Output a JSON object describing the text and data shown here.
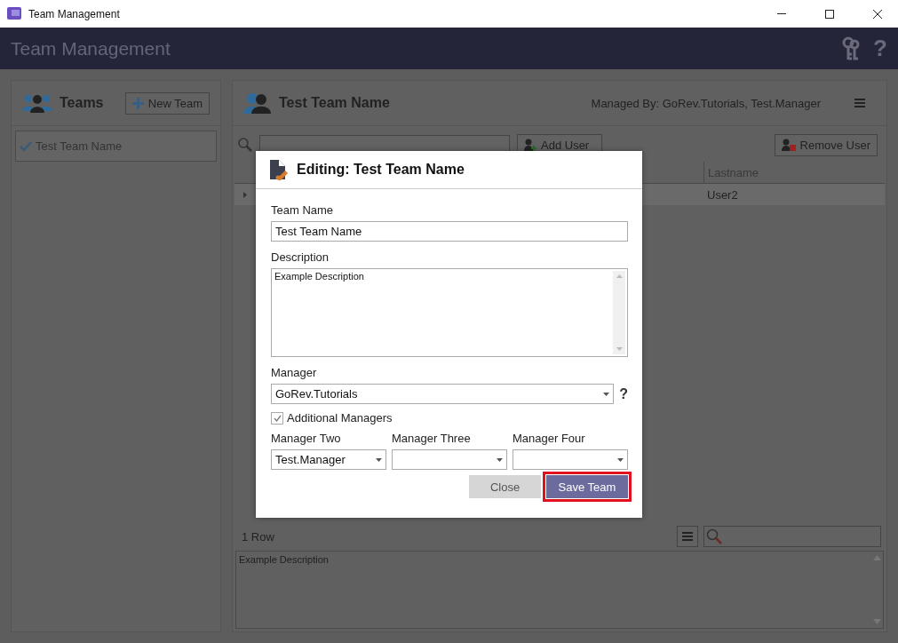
{
  "window": {
    "title": "Team Management"
  },
  "header": {
    "title": "Team Management",
    "help": "?"
  },
  "teams_panel": {
    "title": "Teams",
    "new_button": "New Team",
    "items": [
      {
        "label": "Test Team Name",
        "selected": true
      }
    ]
  },
  "team_panel": {
    "title": "Test Team Name",
    "managed_by": "Managed By: GoRev.Tutorials, Test.Manager",
    "add_button": "Add User",
    "remove_button": "Remove User",
    "table": {
      "columns": [
        "Lastname"
      ],
      "rows": [
        {
          "cells": [
            "User2"
          ]
        }
      ]
    },
    "row_count": "1 Row",
    "description": "Example Description"
  },
  "dialog": {
    "title": "Editing: Test Team Name",
    "team_name": {
      "label": "Team Name",
      "value": "Test Team Name"
    },
    "description": {
      "label": "Description",
      "value": "Example Description"
    },
    "manager": {
      "label": "Manager",
      "value": "GoRev.Tutorials",
      "help": "?"
    },
    "additional_managers": {
      "label": "Additional Managers",
      "checked": true
    },
    "extra_managers": [
      {
        "label": "Manager Two",
        "value": "Test.Manager"
      },
      {
        "label": "Manager Three"
      },
      {
        "label": "Manager Four"
      }
    ],
    "buttons": [
      {
        "kind": "secondary",
        "label": "Close",
        "highlighted": false
      },
      {
        "kind": "primary",
        "label": "Save Team",
        "highlighted": true
      }
    ]
  }
}
